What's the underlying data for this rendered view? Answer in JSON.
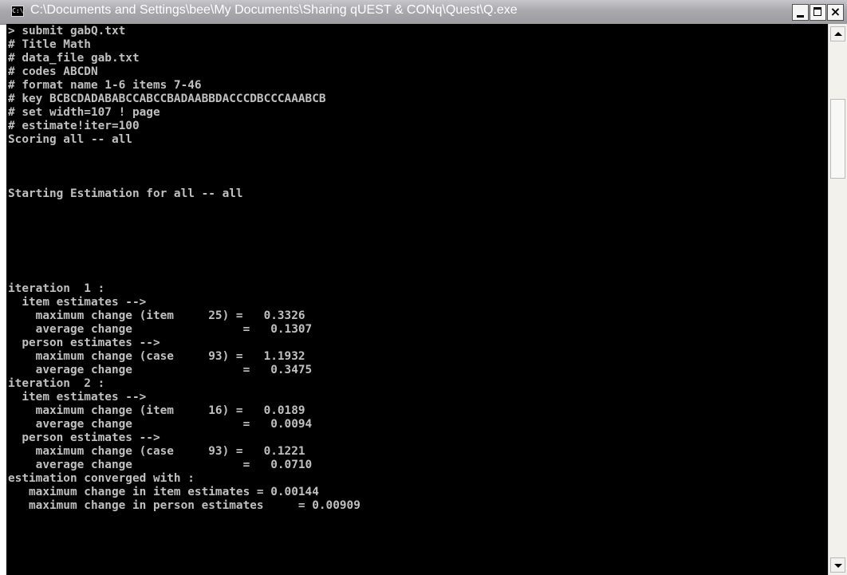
{
  "window": {
    "title": "C:\\Documents and Settings\\bee\\My Documents\\Sharing qUEST & CONq\\Quest\\Q.exe",
    "icon_text": "C:\\",
    "buttons": {
      "minimize": "minimize",
      "maximize": "maximize",
      "close": "×"
    }
  },
  "console": {
    "lines": [
      "> submit gabQ.txt",
      "# Title Math",
      "# data_file gab.txt",
      "# codes ABCDN",
      "# format name 1-6 items 7-46",
      "# key BCBCDADABABCCABCCBADAABBDACCCDBCCCAAABCB",
      "# set width=107 ! page",
      "# estimate!iter=100",
      "Scoring all -- all",
      "",
      "",
      "",
      "Starting Estimation for all -- all",
      "",
      "",
      "",
      "",
      "",
      "",
      "iteration  1 :",
      "  item estimates -->",
      "    maximum change (item     25) =   0.3326",
      "    average change                =   0.1307",
      "  person estimates -->",
      "    maximum change (case     93) =   1.1932",
      "    average change                =   0.3475",
      "iteration  2 :",
      "  item estimates -->",
      "    maximum change (item     16) =   0.0189",
      "    average change                =   0.0094",
      "  person estimates -->",
      "    maximum change (case     93) =   0.1221",
      "    average change                =   0.0710",
      "estimation converged with :",
      "   maximum change in item estimates = 0.00144",
      "   maximum change in person estimates     = 0.00909"
    ]
  },
  "colors": {
    "console_background": "#000000",
    "console_text": "#c0c0c0",
    "titlebar": "#a9a8ad"
  }
}
